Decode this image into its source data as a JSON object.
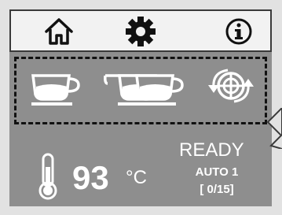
{
  "nav": {
    "home_icon": "home-icon",
    "settings_icon": "gear-icon",
    "info_icon": "info-icon"
  },
  "drinks": [
    {
      "icon": "single-cup-icon"
    },
    {
      "icon": "double-cup-icon"
    },
    {
      "icon": "rinse-cycle-icon"
    }
  ],
  "status": {
    "temperature": "93",
    "unit": "°C",
    "state": "READY",
    "mode": "AUTO 1",
    "counter": "[ 0/15]"
  },
  "colors": {
    "nav_bg": "#f2f2f2",
    "screen_bg": "#8e8e8e",
    "text": "#ffffff",
    "outline": "#111111"
  }
}
